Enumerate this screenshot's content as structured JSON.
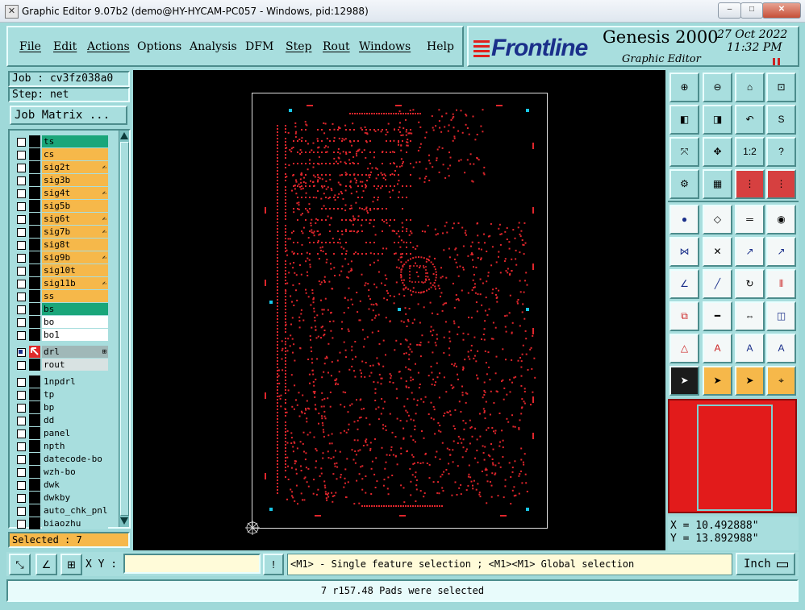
{
  "window": {
    "title": "Graphic Editor 9.07b2 (demo@HY-HYCAM-PC057 - Windows, pid:12988)",
    "min": "–",
    "max": "□",
    "close": "✕"
  },
  "menu": [
    {
      "label": "File"
    },
    {
      "label": "Edit"
    },
    {
      "label": "Actions"
    },
    {
      "label": "Options"
    },
    {
      "label": "Analysis"
    },
    {
      "label": "DFM"
    },
    {
      "label": "Step"
    },
    {
      "label": "Rout"
    },
    {
      "label": "Windows"
    },
    {
      "label": "Help"
    }
  ],
  "brand": {
    "logo": "Frontline",
    "product": "Genesis 2000",
    "subtitle": "Graphic Editor",
    "date": "27 Oct 2022",
    "time": "11:32 PM"
  },
  "job": {
    "job_label": "Job : cv3fz038a0",
    "step_label": "Step: net",
    "matrix_button": "Job Matrix ..."
  },
  "layers": [
    {
      "name": "ts",
      "color": "#1aa67a",
      "signal": false
    },
    {
      "name": "cs",
      "color": "#f6b84a",
      "signal": false
    },
    {
      "name": "sig2t",
      "color": "#f6b84a",
      "signal": true
    },
    {
      "name": "sig3b",
      "color": "#f6b84a",
      "signal": false
    },
    {
      "name": "sig4t",
      "color": "#f6b84a",
      "signal": true
    },
    {
      "name": "sig5b",
      "color": "#f6b84a",
      "signal": false
    },
    {
      "name": "sig6t",
      "color": "#f6b84a",
      "signal": true
    },
    {
      "name": "sig7b",
      "color": "#f6b84a",
      "signal": true
    },
    {
      "name": "sig8t",
      "color": "#f6b84a",
      "signal": false
    },
    {
      "name": "sig9b",
      "color": "#f6b84a",
      "signal": true
    },
    {
      "name": "sig10t",
      "color": "#f6b84a",
      "signal": false
    },
    {
      "name": "sig11b",
      "color": "#f6b84a",
      "signal": true
    },
    {
      "name": "ss",
      "color": "#f6b84a",
      "signal": false
    },
    {
      "name": "bs",
      "color": "#1aa67a",
      "signal": false
    },
    {
      "name": "bo",
      "color": "#ffffff",
      "signal": false
    },
    {
      "name": "bo1",
      "color": "#ffffff",
      "signal": false
    },
    {
      "name": "drl",
      "color": "#a0b8b8",
      "signal": false,
      "active": true
    },
    {
      "name": "rout",
      "color": "#d8e2e2",
      "signal": false
    },
    {
      "name": "1npdrl",
      "color": "#a8dede",
      "signal": false
    },
    {
      "name": "tp",
      "color": "#a8dede",
      "signal": false
    },
    {
      "name": "bp",
      "color": "#a8dede",
      "signal": false
    },
    {
      "name": "dd",
      "color": "#a8dede",
      "signal": false
    },
    {
      "name": "panel",
      "color": "#a8dede",
      "signal": false
    },
    {
      "name": "npth",
      "color": "#a8dede",
      "signal": false
    },
    {
      "name": "datecode-bo",
      "color": "#a8dede",
      "signal": false
    },
    {
      "name": "wzh-bo",
      "color": "#a8dede",
      "signal": false
    },
    {
      "name": "dwk",
      "color": "#a8dede",
      "signal": false
    },
    {
      "name": "dwkby",
      "color": "#a8dede",
      "signal": false
    },
    {
      "name": "auto_chk_pnl",
      "color": "#a8dede",
      "signal": false
    },
    {
      "name": "biaozhu",
      "color": "#a8dede",
      "signal": false
    }
  ],
  "selected_label": "Selected : 7",
  "tools": {
    "ratio_label": "1:2",
    "help_label": "?",
    "icons": [
      "zoom-in-icon",
      "zoom-out-icon",
      "home-icon",
      "zoom-window-icon",
      "pan-left-icon",
      "pan-right-icon",
      "undo-view-icon",
      "redraw-icon",
      "fit-icon",
      "center-icon",
      "ratio-icon",
      "help-icon",
      "settings-icon",
      "grid-icon",
      "layer-display-icon",
      "layer-display-2-icon",
      "add-pad-icon",
      "add-shape-icon",
      "measure-icon",
      "pad-icon",
      "connect-icon",
      "delete-feature-icon",
      "move-icon",
      "move-2-icon",
      "line-icon",
      "slash-icon",
      "rotate-icon",
      "mirror-icon",
      "copy-icon",
      "break-icon",
      "resize-icon",
      "group-icon",
      "angle-icon",
      "text-icon",
      "text-2-icon",
      "text-3-icon",
      "select-arrow-icon",
      "select-box-icon",
      "select-arrow-2-icon",
      "snap-icon"
    ]
  },
  "coords": {
    "x": "X = 10.492888\"",
    "y": "Y = 13.892988\""
  },
  "xy": {
    "label": "X Y :",
    "value": ""
  },
  "hint": "<M1> - Single feature selection ; <M1><M1> Global selection",
  "units": "Inch",
  "status": "7 r157.48 Pads were selected"
}
